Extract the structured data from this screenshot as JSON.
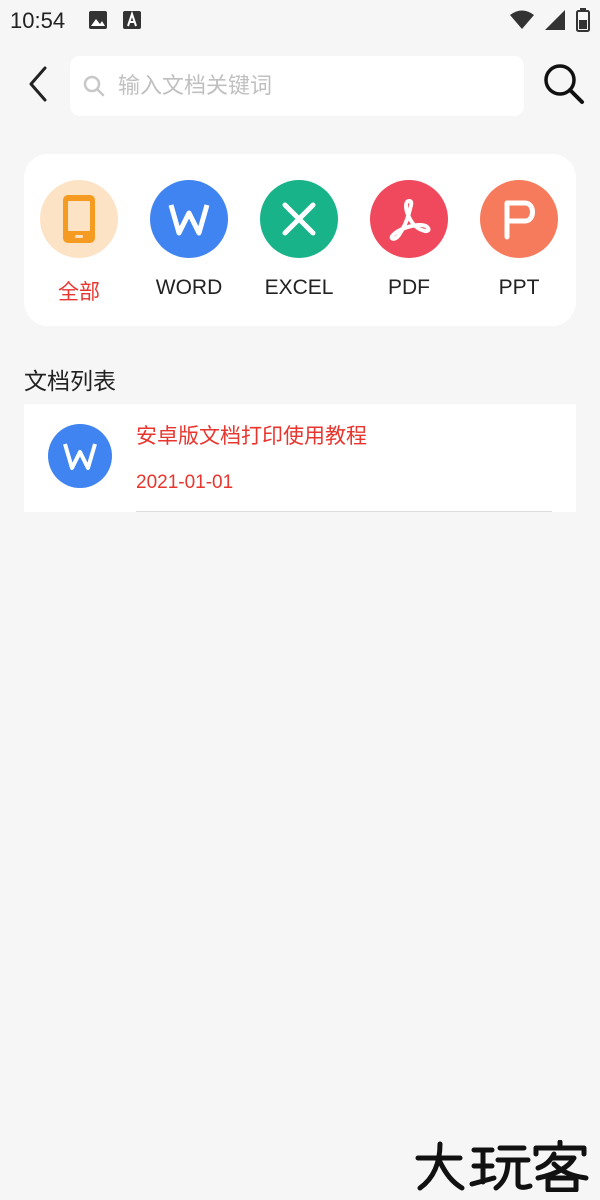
{
  "status_bar": {
    "time": "10:54",
    "left_icons": [
      "image-icon",
      "font-a-icon"
    ],
    "right_icons": [
      "wifi-icon",
      "signal-icon",
      "battery-icon"
    ]
  },
  "header": {
    "back_icon": "chevron-left-icon",
    "search_placeholder": "输入文档关键词",
    "search_value": "",
    "search_icon": "search-icon"
  },
  "categories": [
    {
      "label": "全部",
      "icon": "phone-icon",
      "color": "#fde3c6",
      "active": true
    },
    {
      "label": "WORD",
      "icon": "word-icon",
      "color": "#3f84f0",
      "active": false
    },
    {
      "label": "EXCEL",
      "icon": "excel-icon",
      "color": "#19b38a",
      "active": false
    },
    {
      "label": "PDF",
      "icon": "pdf-icon",
      "color": "#f0485c",
      "active": false
    },
    {
      "label": "PPT",
      "icon": "ppt-icon",
      "color": "#f57b5c",
      "active": false
    }
  ],
  "section": {
    "title": "文档列表"
  },
  "documents": [
    {
      "title": "安卓版文档打印使用教程",
      "date": "2021-01-01",
      "type": "word-icon"
    }
  ],
  "colors": {
    "accent": "#e8352e",
    "background": "#f6f6f6"
  },
  "watermark": {
    "text": "大玩客"
  }
}
